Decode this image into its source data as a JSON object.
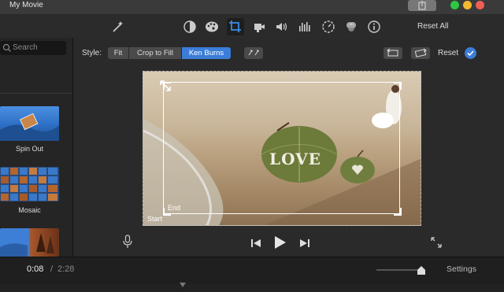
{
  "window": {
    "title": "My Movie"
  },
  "toolbar": {
    "reset_all": "Reset All"
  },
  "sidebar": {
    "search_placeholder": "Search",
    "transitions": [
      {
        "label": "Spin Out"
      },
      {
        "label": "Mosaic"
      }
    ]
  },
  "style_bar": {
    "label": "Style:",
    "options": [
      "Fit",
      "Crop to Fill",
      "Ken Burns"
    ],
    "selected": "Ken Burns",
    "reset": "Reset"
  },
  "viewer": {
    "overlay_text": "LOVE",
    "start_label": "Start",
    "end_label": "End"
  },
  "timeline": {
    "current_time": "0:08",
    "separator": "/",
    "total_time": "2:28",
    "settings": "Settings"
  },
  "colors": {
    "accent": "#3b7dd8",
    "traffic_green": "#2bc840",
    "traffic_yellow": "#f5b82e",
    "traffic_red": "#ed5e55"
  }
}
